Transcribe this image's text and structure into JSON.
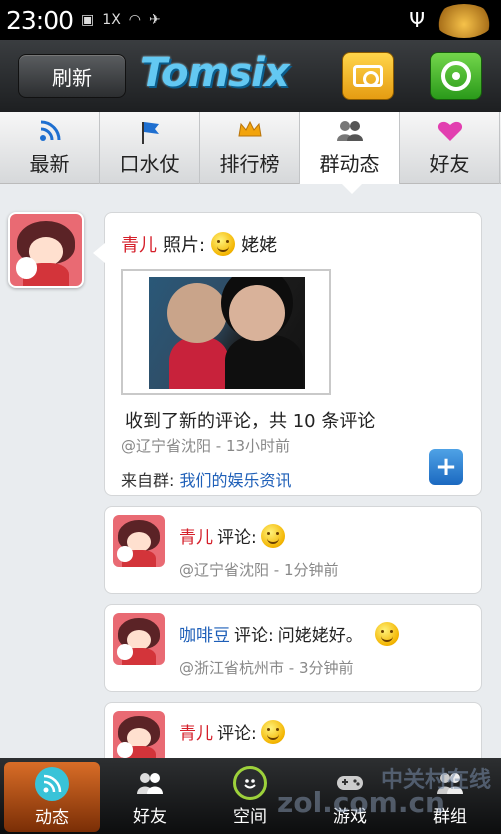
{
  "status_bar": {
    "time": "23:00",
    "signal_text": "1X"
  },
  "header": {
    "refresh_label": "刷新",
    "logo_text": "Tomsix",
    "camera_icon": "camera-icon",
    "compass_icon": "compass-icon"
  },
  "tabs": [
    {
      "label": "最新",
      "icon": "rss-icon"
    },
    {
      "label": "口水仗",
      "icon": "flag-icon"
    },
    {
      "label": "排行榜",
      "icon": "crown-icon"
    },
    {
      "label": "群动态",
      "icon": "group-icon",
      "active": true
    },
    {
      "label": "好友",
      "icon": "heart-icon"
    }
  ],
  "post": {
    "author": "青儿",
    "type_label": "照片:",
    "caption": "姥姥",
    "comment_summary": "收到了新的评论，共 10 条评论",
    "location_time": "@辽宁省沈阳 - 13小时前",
    "from_label": "来自群:",
    "group_name": "我们的娱乐资讯"
  },
  "comments": [
    {
      "author": "青儿",
      "action": "评论:",
      "text": "",
      "location_time": "@辽宁省沈阳 - 1分钟前"
    },
    {
      "author": "咖啡豆",
      "action": "评论:",
      "text": "问姥姥好。",
      "location_time": "@浙江省杭州市 - 3分钟前"
    },
    {
      "author": "青儿",
      "action": "评论:",
      "text": "",
      "location_time": ""
    }
  ],
  "bottom_nav": [
    {
      "label": "动态",
      "icon": "feed-icon",
      "active": true
    },
    {
      "label": "好友",
      "icon": "friends-icon"
    },
    {
      "label": "空间",
      "icon": "space-icon"
    },
    {
      "label": "游戏",
      "icon": "gamepad-icon"
    },
    {
      "label": "群组",
      "icon": "group-icon"
    }
  ],
  "watermark": {
    "line1": "中关村在线",
    "line2": "zol.com.cn"
  },
  "colors": {
    "accent_orange": "#d96d27",
    "name_red": "#d51f2a",
    "link_blue": "#1e5fb8"
  }
}
